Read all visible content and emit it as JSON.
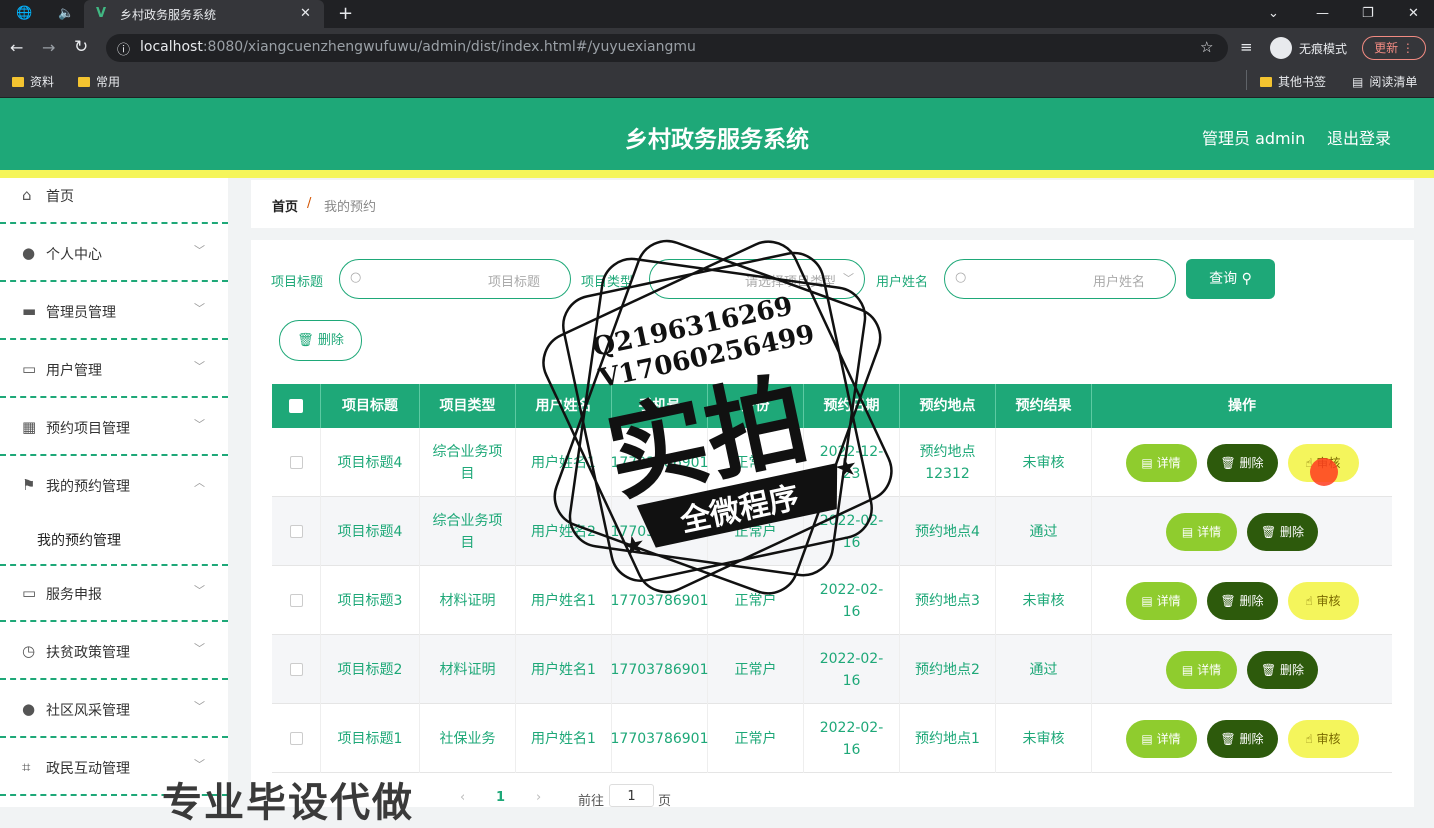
{
  "browser": {
    "tab_title": "乡村政务服务系统",
    "url_host": "localhost",
    "url_rest": ":8080/xiangcuenzhengwufuwu/admin/dist/index.html#/yuyuexiangmu",
    "incognito_label": "无痕模式",
    "update_label": "更新",
    "bookmarks": [
      "资料",
      "常用"
    ],
    "other_bookmarks": "其他书签",
    "reading_list": "阅读清单"
  },
  "header": {
    "title": "乡村政务服务系统",
    "user": "管理员 admin",
    "logout": "退出登录"
  },
  "sidebar": {
    "items": [
      {
        "label": "首页",
        "icon": "home-icon"
      },
      {
        "label": "个人中心",
        "icon": "user-icon"
      },
      {
        "label": "管理员管理",
        "icon": "briefcase-icon"
      },
      {
        "label": "用户管理",
        "icon": "chat-icon"
      },
      {
        "label": "预约项目管理",
        "icon": "grid-icon"
      },
      {
        "label": "我的预约管理",
        "icon": "flag-icon"
      },
      {
        "label": "我的预约管理"
      },
      {
        "label": "服务申报",
        "icon": "message-icon"
      },
      {
        "label": "扶贫政策管理",
        "icon": "clock-icon"
      },
      {
        "label": "社区风采管理",
        "icon": "person-icon"
      },
      {
        "label": "政民互动管理",
        "icon": "crop-icon"
      }
    ]
  },
  "breadcrumb": {
    "home": "首页",
    "sep": "/",
    "current": "我的预约"
  },
  "filters": {
    "title_label": "项目标题",
    "title_placeholder": "项目标题",
    "type_label": "项目类型",
    "type_placeholder": "请选择项目类型",
    "name_label": "用户姓名",
    "name_placeholder": "用户姓名",
    "search_button": "查询",
    "delete_button": "删除"
  },
  "table": {
    "headers": [
      "项目标题",
      "项目类型",
      "用户姓名",
      "手机号",
      "身份",
      "预约日期",
      "预约地点",
      "预约结果",
      "操作"
    ],
    "rows": [
      {
        "title": "项目标题4",
        "type": "综合业务项目",
        "name": "用户姓名1",
        "phone": "17703786901",
        "identity": "正常户",
        "date": "2022-12-23",
        "place": "预约地点12312",
        "result": "未审核",
        "audit": true
      },
      {
        "title": "项目标题4",
        "type": "综合业务项目",
        "name": "用户姓名2",
        "phone": "17703786901",
        "identity": "正常户",
        "date": "2022-02-16",
        "place": "预约地点4",
        "result": "通过",
        "audit": false
      },
      {
        "title": "项目标题3",
        "type": "材料证明",
        "name": "用户姓名1",
        "phone": "17703786901",
        "identity": "正常户",
        "date": "2022-02-16",
        "place": "预约地点3",
        "result": "未审核",
        "audit": true
      },
      {
        "title": "项目标题2",
        "type": "材料证明",
        "name": "用户姓名1",
        "phone": "17703786901",
        "identity": "正常户",
        "date": "2022-02-16",
        "place": "预约地点2",
        "result": "通过",
        "audit": false
      },
      {
        "title": "项目标题1",
        "type": "社保业务",
        "name": "用户姓名1",
        "phone": "17703786901",
        "identity": "正常户",
        "date": "2022-02-16",
        "place": "预约地点1",
        "result": "未审核",
        "audit": true
      }
    ],
    "btn_detail": "详情",
    "btn_delete": "删除",
    "btn_audit": "审核"
  },
  "pager": {
    "page": "1",
    "goto": "前往",
    "page_unit": "页",
    "goto_value": "1"
  },
  "watermark": {
    "line1": "Q2196316269",
    "line2": "V17060256499",
    "big": "实拍",
    "banner": "全微程序",
    "bottom": "专业毕设代做"
  },
  "colors": {
    "primary": "#1ea878",
    "accent_yellow": "#f5f55a",
    "detail": "#8fcc2e",
    "delete": "#2d5a0c",
    "audit": "#f4f55c"
  }
}
